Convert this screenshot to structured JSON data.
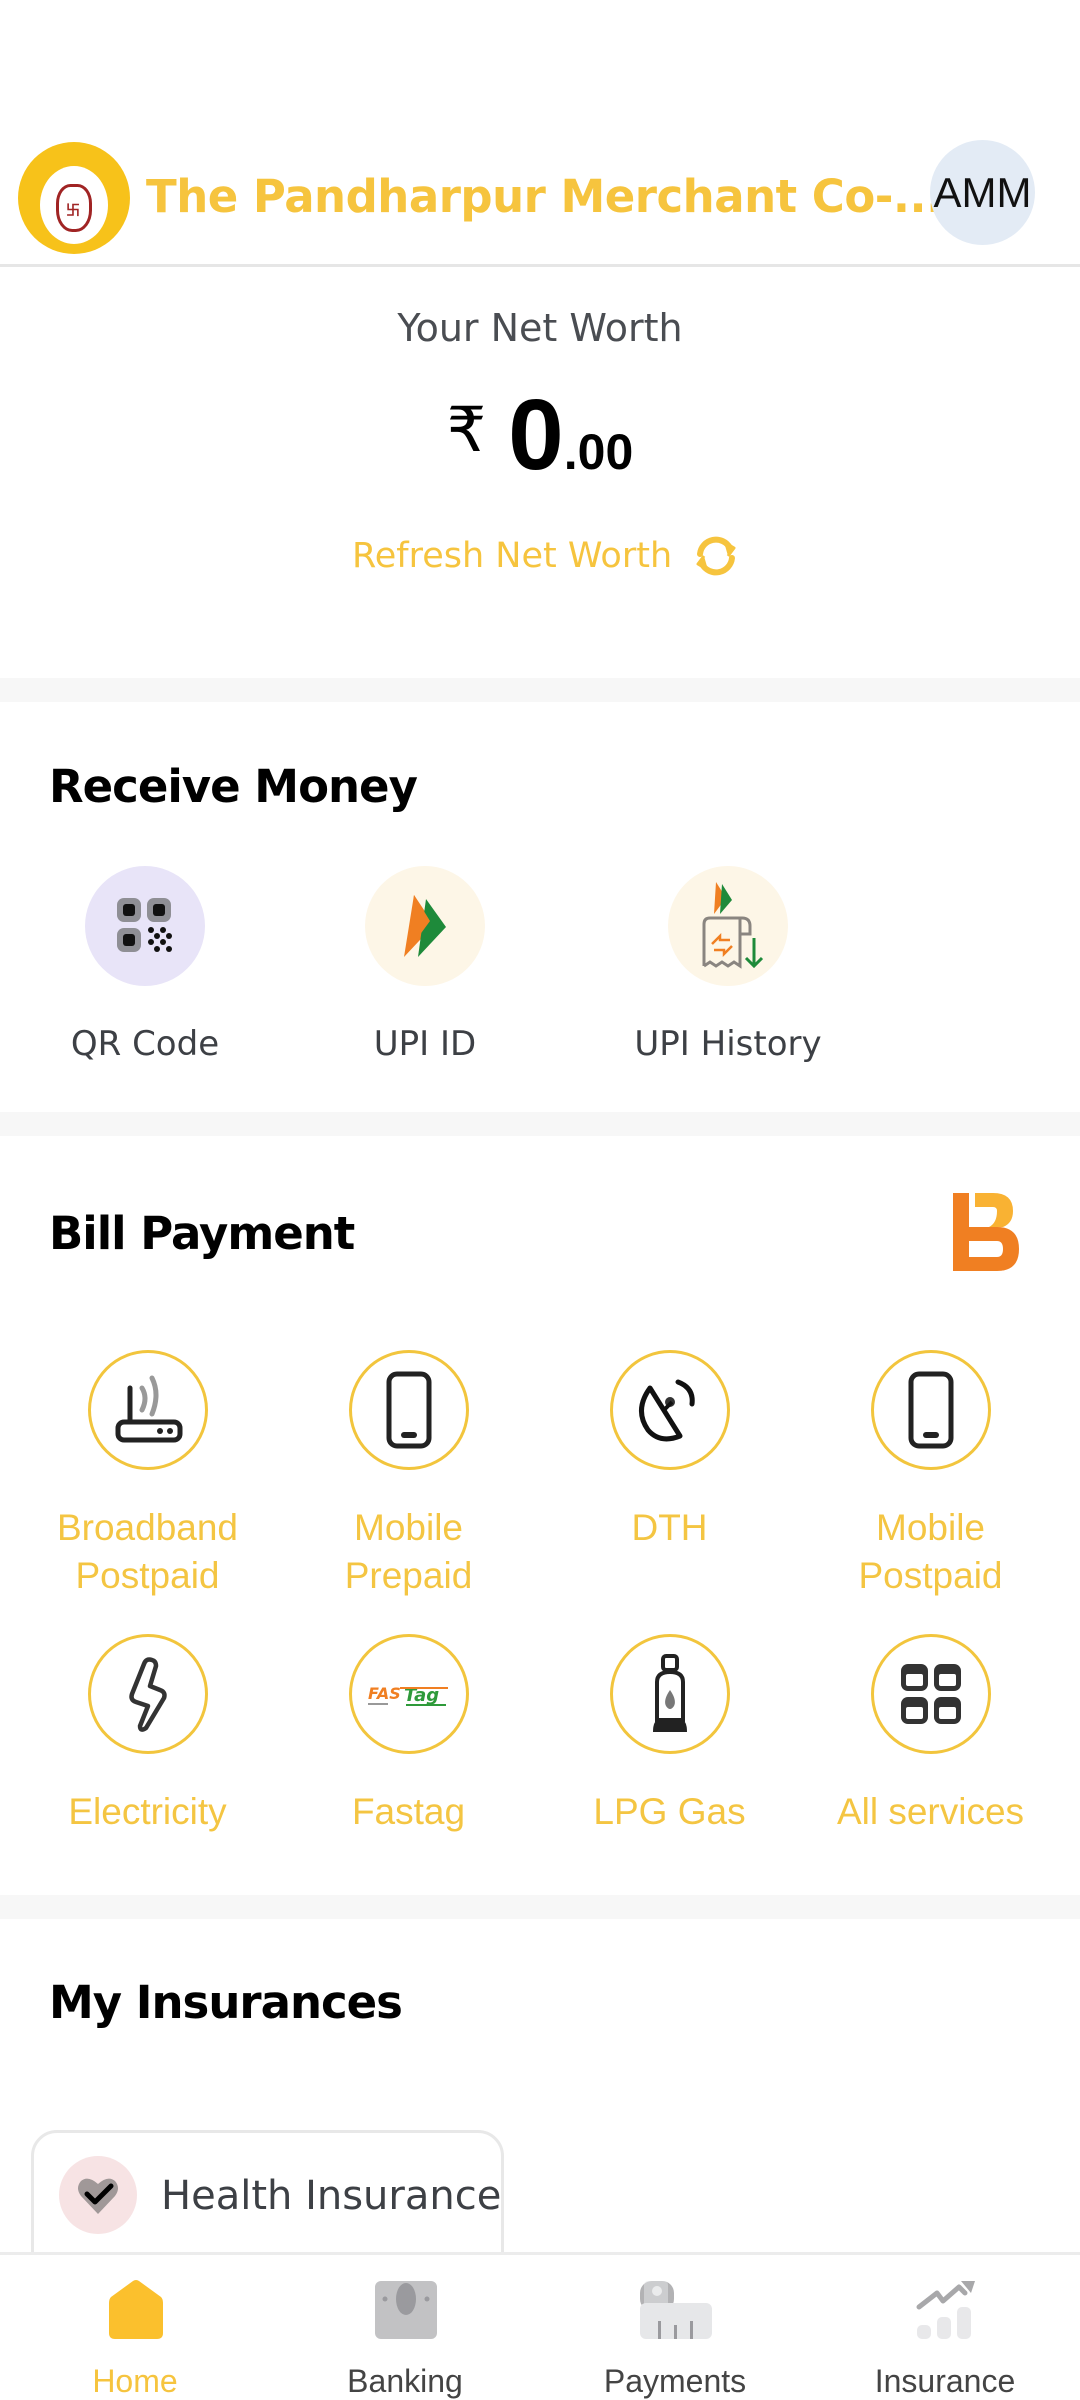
{
  "header": {
    "bank_name": "The Pandharpur Merchant Co-...",
    "avatar_initials": "AMM",
    "logo_alt": "bank-logo"
  },
  "net_worth": {
    "label": "Your Net Worth",
    "currency_symbol": "₹",
    "amount_integer": "0",
    "amount_decimal": ".00",
    "refresh_label": "Refresh Net Worth"
  },
  "receive_money": {
    "title": "Receive Money",
    "items": [
      {
        "label": "QR Code",
        "icon": "qr-code-icon"
      },
      {
        "label": "UPI ID",
        "icon": "upi-icon"
      },
      {
        "label": "UPI History",
        "icon": "upi-history-icon"
      }
    ]
  },
  "bill_payment": {
    "title": "Bill Payment",
    "brand_icon": "bbps-logo-icon",
    "items": [
      {
        "label": "Broadband\nPostpaid",
        "line1": "Broadband",
        "line2": "Postpaid",
        "icon": "router-icon"
      },
      {
        "label": "Mobile\nPrepaid",
        "line1": "Mobile",
        "line2": "Prepaid",
        "icon": "mobile-phone-icon"
      },
      {
        "label": "DTH",
        "line1": "DTH",
        "line2": "",
        "icon": "satellite-dish-icon"
      },
      {
        "label": "Mobile\nPostpaid",
        "line1": "Mobile",
        "line2": "Postpaid",
        "icon": "mobile-phone-icon"
      },
      {
        "label": "Electricity",
        "line1": "Electricity",
        "line2": "",
        "icon": "lightning-bolt-icon"
      },
      {
        "label": "Fastag",
        "line1": "Fastag",
        "line2": "",
        "icon": "fastag-logo-icon"
      },
      {
        "label": "LPG Gas",
        "line1": "LPG Gas",
        "line2": "",
        "icon": "gas-cylinder-icon"
      },
      {
        "label": "All services",
        "line1": "All services",
        "line2": "",
        "icon": "grid-icon"
      }
    ]
  },
  "insurances": {
    "title": "My Insurances",
    "items": [
      {
        "label": "Health Insurance",
        "icon": "heart-check-icon"
      }
    ]
  },
  "bottom_nav": {
    "items": [
      {
        "label": "Home",
        "icon": "home-icon",
        "active": true
      },
      {
        "label": "Banking",
        "icon": "banknote-icon",
        "active": false
      },
      {
        "label": "Payments",
        "icon": "payments-icon",
        "active": false
      },
      {
        "label": "Insurance",
        "icon": "growth-chart-icon",
        "active": false
      }
    ]
  },
  "colors": {
    "accent": "#f6c43e",
    "home_active": "#fbc02d",
    "text_dark": "#000000",
    "text_muted": "#3d4045",
    "avatar_bg": "#e3ebf5",
    "separator": "#f7f7f7",
    "bbps_orange": "#f07f22"
  }
}
